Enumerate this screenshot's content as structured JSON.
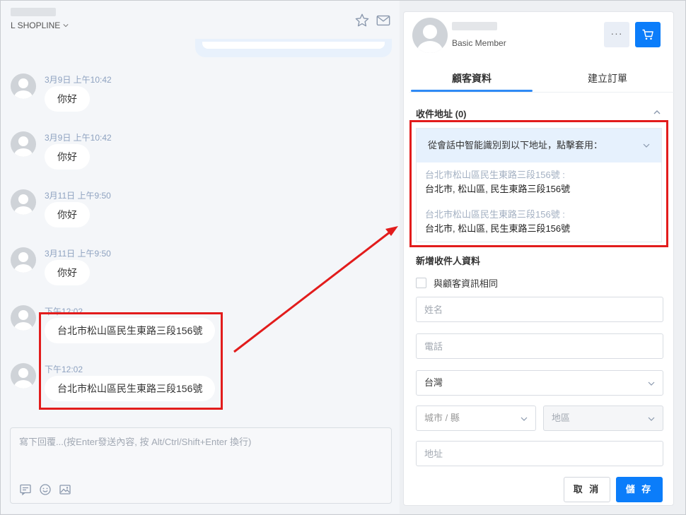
{
  "chat": {
    "store_name": "L SHOPLINE",
    "messages": [
      {
        "time": "3月9日 上午10:42",
        "text": "你好"
      },
      {
        "time": "3月9日 上午10:42",
        "text": "你好"
      },
      {
        "time": "3月11日 上午9:50",
        "text": "你好"
      },
      {
        "time": "3月11日 上午9:50",
        "text": "你好"
      },
      {
        "time": "下午12:02",
        "text": "台北市松山區民生東路三段156號"
      },
      {
        "time": "下午12:02",
        "text": "台北市松山區民生東路三段156號"
      }
    ],
    "composer_placeholder": "寫下回覆...(按Enter發送內容, 按 Alt/Ctrl/Shift+Enter 換行)"
  },
  "panel": {
    "member_level": "Basic Member",
    "more_label": "···",
    "tabs": [
      {
        "label": "顧客資料",
        "active": true
      },
      {
        "label": "建立訂單",
        "active": false
      }
    ],
    "address_section": {
      "title": "收件地址 (0)",
      "suggestion_header": "從會話中智能識別到以下地址，點擊套用：",
      "items": [
        {
          "source": "台北市松山區民生東路三段156號 :",
          "value": "台北市, 松山區, 民生東路三段156號"
        },
        {
          "source": "台北市松山區民生東路三段156號 :",
          "value": "台北市, 松山區, 民生東路三段156號"
        }
      ]
    },
    "new_recipient": {
      "title": "新增收件人資料",
      "same_as_customer": "與顧客資訊相同",
      "name_placeholder": "姓名",
      "phone_placeholder": "電話",
      "country_value": "台灣",
      "city_placeholder": "城市 / 縣",
      "district_placeholder": "地區",
      "address_placeholder": "地址"
    },
    "buttons": {
      "cancel": "取 消",
      "save": "儲 存"
    }
  },
  "colors": {
    "accent": "#0b7dfa",
    "annotation": "#e21c1c",
    "suggest_bg": "#e6f1fd"
  }
}
